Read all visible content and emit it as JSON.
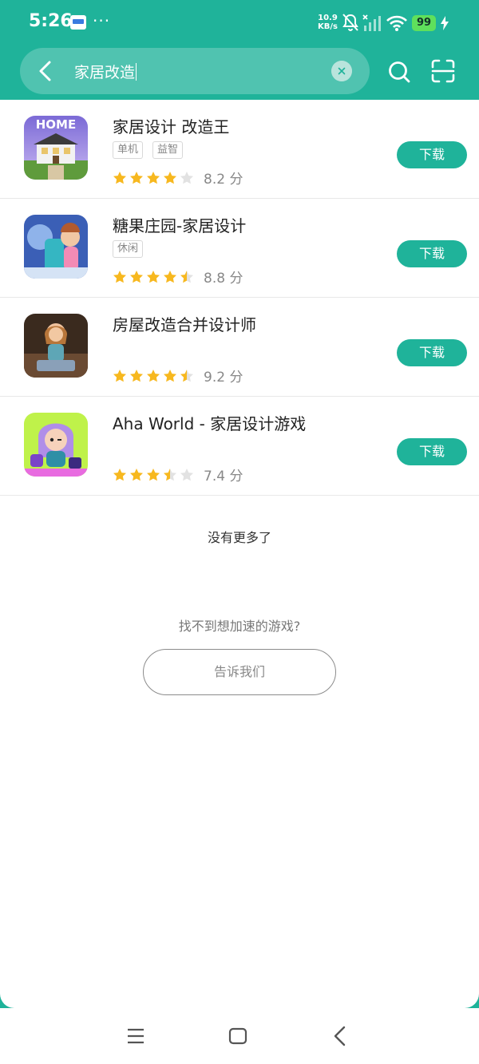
{
  "status_bar": {
    "time": "5:26",
    "net_speed_value": "10.9",
    "net_speed_unit": "KB/s",
    "battery": "99"
  },
  "search": {
    "query": "家居改造"
  },
  "results": [
    {
      "name": "家居设计 改造王",
      "tags": [
        "单机",
        "益智"
      ],
      "rating": 4,
      "score": "8.2 分",
      "button": "下载"
    },
    {
      "name": "糖果庄园-家居设计",
      "tags": [
        "休闲"
      ],
      "rating": 4.5,
      "score": "8.8 分",
      "button": "下载"
    },
    {
      "name": "房屋改造合并设计师",
      "tags": [],
      "rating": 4.5,
      "score": "9.2 分",
      "button": "下载"
    },
    {
      "name": "Aha World - 家居设计游戏",
      "tags": [],
      "rating": 3.5,
      "score": "7.4 分",
      "button": "下载"
    }
  ],
  "footer": {
    "no_more": "没有更多了",
    "not_found": "找不到想加速的游戏?",
    "tell_us": "告诉我们"
  },
  "icon1_text": "HOME",
  "colors": {
    "accent": "#1fb39a",
    "star": "#f7b81f",
    "star_empty": "#e2e2e2"
  }
}
